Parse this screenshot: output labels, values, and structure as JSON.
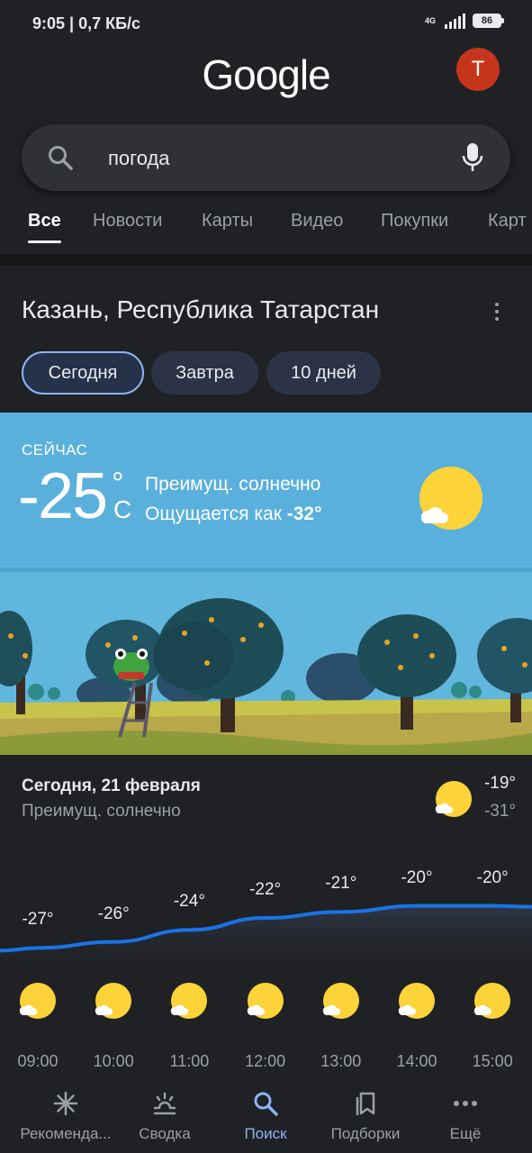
{
  "status_bar": {
    "time": "9:05 | 0,7 КБ/с",
    "network": "4G",
    "battery": "86"
  },
  "header": {
    "logo": "Google",
    "avatar_letter": "T"
  },
  "search": {
    "query": "погода"
  },
  "tabs": [
    "Все",
    "Новости",
    "Карты",
    "Видео",
    "Покупки",
    "Карт"
  ],
  "weather": {
    "location": "Казань, Республика Татарстан",
    "chips": [
      "Сегодня",
      "Завтра",
      "10 дней"
    ],
    "now_label": "СЕЙЧАС",
    "temp": "-25",
    "deg": "°",
    "unit": "C",
    "condition": "Преимущ. солнечно",
    "feels_prefix": "Ощущается как ",
    "feels_value": "-32°",
    "today_title": "Сегодня, 21 февраля",
    "today_condition": "Преимущ. солнечно",
    "high": "-19°",
    "low": "-31°",
    "hourly": [
      {
        "time": "09:00",
        "label": "-27°",
        "temp": -27
      },
      {
        "time": "10:00",
        "label": "-26°",
        "temp": -26
      },
      {
        "time": "11:00",
        "label": "-24°",
        "temp": -24
      },
      {
        "time": "12:00",
        "label": "-22°",
        "temp": -22
      },
      {
        "time": "13:00",
        "label": "-21°",
        "temp": -21
      },
      {
        "time": "14:00",
        "label": "-20°",
        "temp": -20
      },
      {
        "time": "15:00",
        "label": "-20°",
        "temp": -20
      }
    ]
  },
  "bottom_nav": [
    {
      "label": "Рекоменда...",
      "icon": "asterisk-icon"
    },
    {
      "label": "Сводка",
      "icon": "sunrise-icon"
    },
    {
      "label": "Поиск",
      "icon": "search-icon"
    },
    {
      "label": "Подборки",
      "icon": "collections-icon"
    },
    {
      "label": "Ещё",
      "icon": "more-dots-icon"
    }
  ],
  "colors": {
    "accent": "#8ab4f8",
    "sky": "#5ab0dc",
    "avatar": "#c5351b",
    "graph_line": "#1a73e8"
  }
}
